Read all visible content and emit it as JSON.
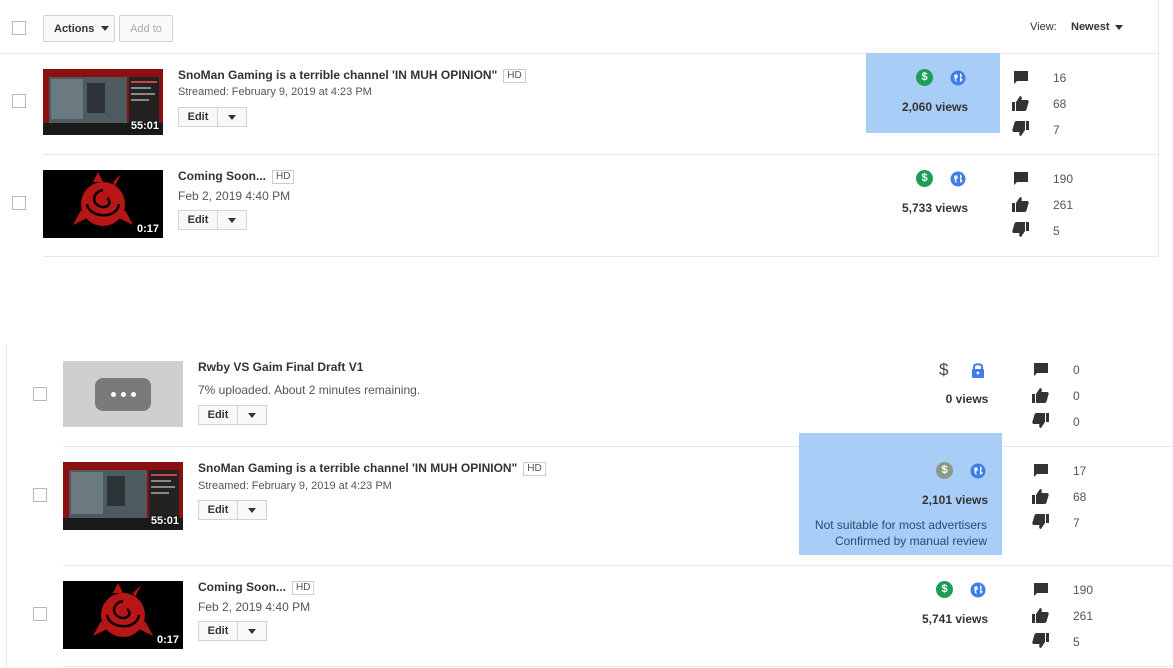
{
  "toolbar": {
    "actions_label": "Actions",
    "add_to_label": "Add to",
    "view_label": "View:",
    "view_value": "Newest"
  },
  "panel1": [
    {
      "title": "SnoMan Gaming is a terrible channel 'IN MUH OPINION\"",
      "badge": "HD",
      "date": "Streamed: February 9, 2019 at 4:23 PM",
      "duration": "55:01",
      "edit_label": "Edit",
      "views": "2,060 views",
      "comments": "16",
      "likes": "68",
      "dislikes": "7"
    },
    {
      "title": "Coming Soon...",
      "badge": "HD",
      "date": "Feb 2, 2019 4:40 PM",
      "duration": "0:17",
      "edit_label": "Edit",
      "views": "5,733 views",
      "comments": "190",
      "likes": "261",
      "dislikes": "5"
    }
  ],
  "panel2": [
    {
      "title": "Rwby VS Gaim Final Draft V1",
      "status": "7% uploaded. About 2 minutes remaining.",
      "edit_label": "Edit",
      "views": "0 views",
      "comments": "0",
      "likes": "0",
      "dislikes": "0"
    },
    {
      "title": "SnoMan Gaming is a terrible channel 'IN MUH OPINION\"",
      "badge": "HD",
      "date": "Streamed: February 9, 2019 at 4:23 PM",
      "duration": "55:01",
      "edit_label": "Edit",
      "views": "2,101 views",
      "note_line1": "Not suitable for most advertisers",
      "note_line2": "Confirmed by manual review",
      "comments": "17",
      "likes": "68",
      "dislikes": "7"
    },
    {
      "title": "Coming Soon...",
      "badge": "HD",
      "date": "Feb 2, 2019 4:40 PM",
      "duration": "0:17",
      "edit_label": "Edit",
      "views": "5,741 views",
      "comments": "190",
      "likes": "261",
      "dislikes": "5"
    }
  ],
  "icons": {
    "monetized_color": "#1e9d57",
    "limited_color": "#8a9a84",
    "globe_color": "#3f7ee8",
    "lock_color": "#3f7ee8",
    "highlight_color": "#a8cdf7"
  }
}
